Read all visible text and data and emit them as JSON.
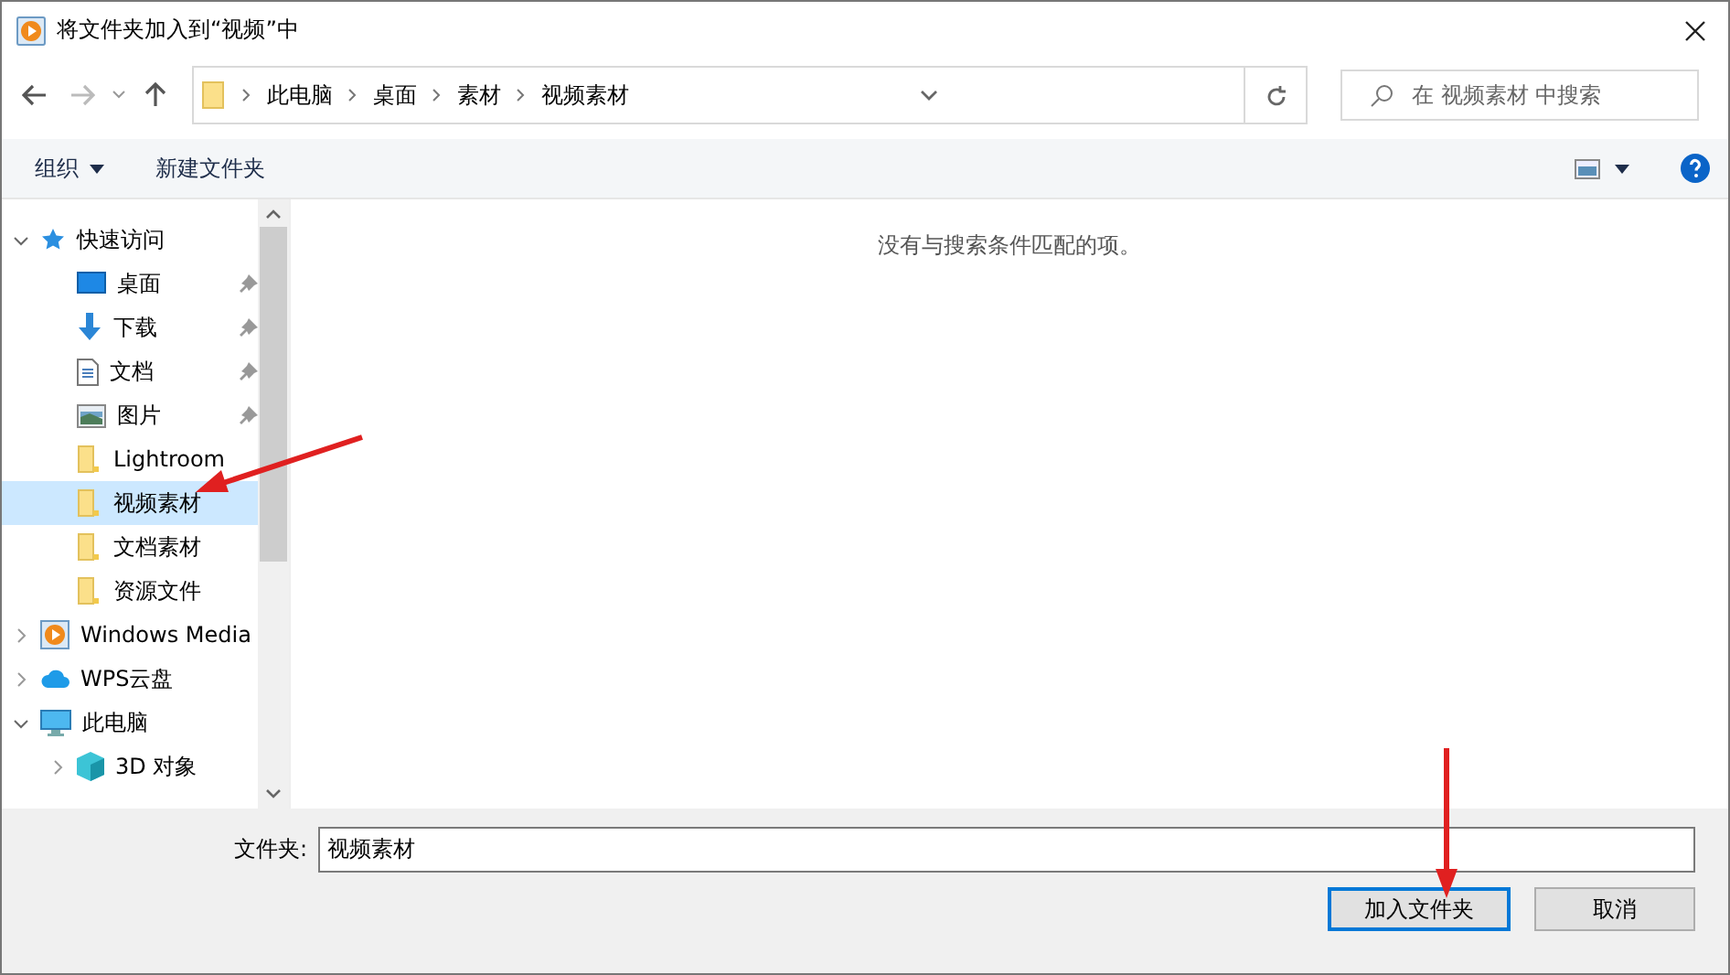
{
  "window": {
    "title": "将文件夹加入到“视频”中"
  },
  "address": {
    "path": [
      "此电脑",
      "桌面",
      "素材",
      "视频素材"
    ]
  },
  "search": {
    "placeholder": "在 视频素材 中搜索"
  },
  "toolbar": {
    "organize": "组织",
    "new_folder": "新建文件夹"
  },
  "sidebar": {
    "items": [
      {
        "label": "快速访问",
        "kind": "star",
        "expanded": true,
        "selected": false,
        "children": [
          {
            "label": "桌面",
            "kind": "desktop",
            "pinned": true,
            "selected": false
          },
          {
            "label": "下载",
            "kind": "download",
            "pinned": true,
            "selected": false
          },
          {
            "label": "文档",
            "kind": "document",
            "pinned": true,
            "selected": false
          },
          {
            "label": "图片",
            "kind": "image",
            "pinned": true,
            "selected": false
          },
          {
            "label": "Lightroom",
            "kind": "folder",
            "pinned": false,
            "selected": false
          },
          {
            "label": "视频素材",
            "kind": "folder",
            "pinned": false,
            "selected": true
          },
          {
            "label": "文档素材",
            "kind": "folder",
            "pinned": false,
            "selected": false
          },
          {
            "label": "资源文件",
            "kind": "folder",
            "pinned": false,
            "selected": false
          }
        ]
      },
      {
        "label": "Windows Media",
        "kind": "media",
        "expanded": false,
        "selected": false
      },
      {
        "label": "WPS云盘",
        "kind": "cloud",
        "expanded": false,
        "selected": false
      },
      {
        "label": "此电脑",
        "kind": "pc",
        "expanded": true,
        "selected": false,
        "children": [
          {
            "label": "3D 对象",
            "kind": "cube",
            "expanded": false,
            "selected": false
          }
        ]
      }
    ]
  },
  "content": {
    "empty_message": "没有与搜索条件匹配的项。"
  },
  "footer": {
    "folder_label": "文件夹:",
    "folder_value": "视频素材",
    "buttons": [
      {
        "label": "加入文件夹",
        "kind": "primary"
      },
      {
        "label": "取消",
        "kind": "secondary"
      }
    ]
  }
}
